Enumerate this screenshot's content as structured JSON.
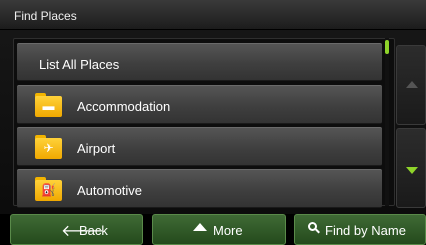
{
  "window": {
    "title": "Find Places"
  },
  "list": {
    "items": [
      {
        "label": "List All Places",
        "icon": ""
      },
      {
        "label": "Accommodation",
        "icon": "bed-icon"
      },
      {
        "label": "Airport",
        "icon": "airplane-icon"
      },
      {
        "label": "Automotive",
        "icon": "fuel-pump-icon"
      }
    ]
  },
  "toolbar": {
    "back_label": "Back",
    "more_label": "More",
    "find_label": "Find by Name"
  },
  "colors": {
    "accent_green": "#8fd42a",
    "folder_yellow": "#ffd23a",
    "button_green": "#2f5a26"
  }
}
